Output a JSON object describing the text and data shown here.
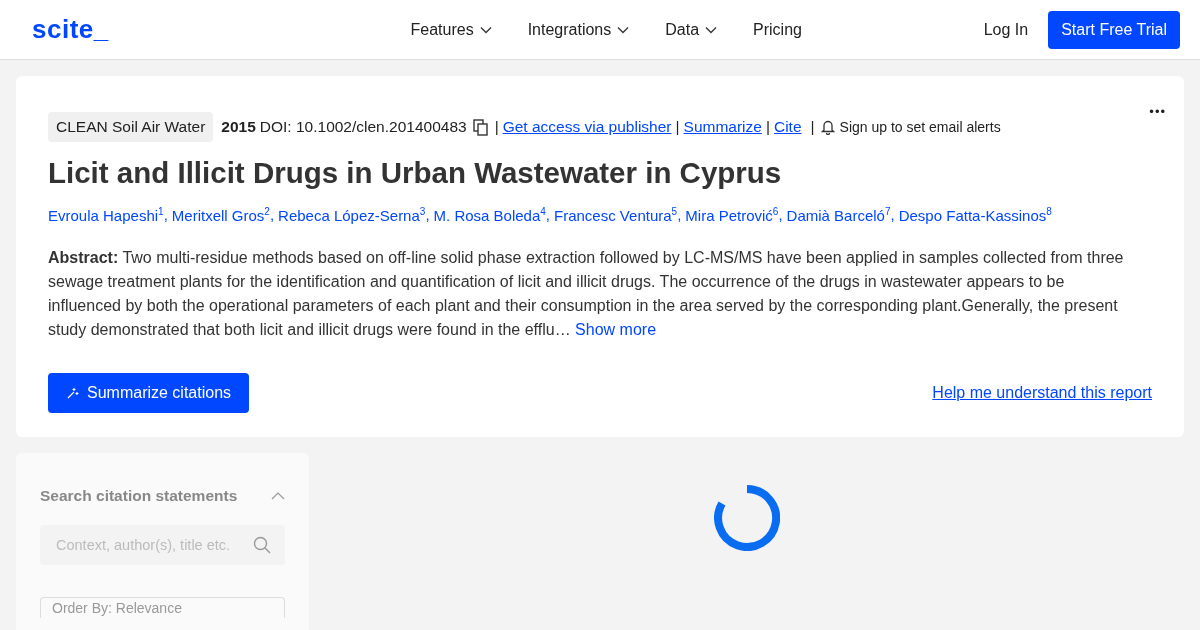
{
  "header": {
    "logo": "scite_",
    "nav": [
      {
        "label": "Features",
        "dropdown": true
      },
      {
        "label": "Integrations",
        "dropdown": true
      },
      {
        "label": "Data",
        "dropdown": true
      },
      {
        "label": "Pricing",
        "dropdown": false
      }
    ],
    "login": "Log In",
    "cta": "Start Free Trial"
  },
  "paper": {
    "journal": "CLEAN Soil Air Water",
    "year": "2015",
    "doi": "DOI: 10.1002/clen.201400483",
    "links": [
      {
        "separator": "|",
        "label": "Get access via publisher"
      },
      {
        "separator": "|",
        "label": "Summarize"
      },
      {
        "separator": "|",
        "label": "Cite"
      }
    ],
    "alerts_separator": "|",
    "alerts": "Sign up to set email alerts",
    "more": "•••",
    "title": "Licit and Illicit Drugs in Urban Wastewater in Cyprus",
    "authors": [
      {
        "name": "Evroula Hapeshi",
        "affiliation": "1",
        "suffix": ","
      },
      {
        "name": "Meritxell Gros",
        "affiliation": "2",
        "suffix": ","
      },
      {
        "name": "Rebeca López-Serna",
        "affiliation": "3",
        "suffix": ","
      },
      {
        "name": "M. Rosa Boleda",
        "affiliation": "4",
        "suffix": ","
      },
      {
        "name": "Francesc Ventura",
        "affiliation": "5",
        "suffix": ","
      },
      {
        "name": "Mira Petrović",
        "affiliation": "6",
        "suffix": ","
      },
      {
        "name": "Damià Barceló",
        "affiliation": "7",
        "suffix": ","
      },
      {
        "name": "Despo Fatta-Kassinos",
        "affiliation": "8"
      }
    ],
    "abstract": "**Abstract:** Two multi-residue methods based on off-line solid phase extraction followed by LC-MS/MS have been applied in samples collected from three sewage treatment plants for the identification and quantification of licit and illicit drugs. The occurrence of the drugs in wastewater appears to be influenced by both the operational parameters of each plant and their consumption in the area served by the corresponding plant.Generally, the present study demonstrated that both licit and illicit drugs were found in the efflu…",
    "show_more": "Show more",
    "summarize_button": "Summarize citations",
    "help_link": "Help me understand this report"
  },
  "sidebar": {
    "heading": "Search citation statements",
    "expanded": true,
    "search": {
      "placeholder": "Context, author(s), title etc."
    },
    "order": "Order By: Relevance"
  },
  "loading": true
}
